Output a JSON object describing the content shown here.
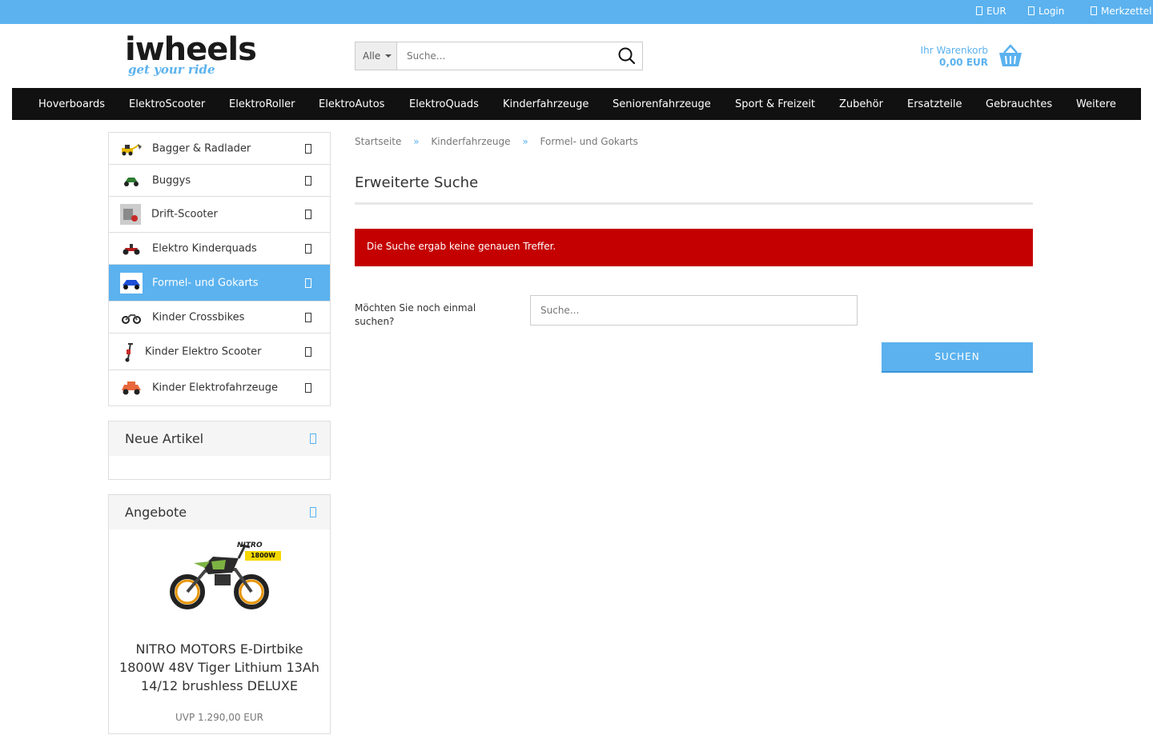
{
  "topbar": {
    "currency": "EUR",
    "login": "Login",
    "wishlist": "Merkzettel"
  },
  "logo": {
    "main": "iwheels",
    "tagline": "get your ride"
  },
  "search": {
    "category": "Alle",
    "placeholder": "Suche..."
  },
  "cart": {
    "label": "Ihr Warenkorb",
    "total": "0,00 EUR"
  },
  "nav": [
    "Hoverboards",
    "ElektroScooter",
    "ElektroRoller",
    "ElektroAutos",
    "ElektroQuads",
    "Kinderfahrzeuge",
    "Seniorenfahrzeuge",
    "Sport & Freizeit",
    "Zubehör",
    "Ersatzteile",
    "Gebrauchtes",
    "Weitere"
  ],
  "sidebar": {
    "categories": [
      {
        "label": "Bagger & Radlader"
      },
      {
        "label": "Buggys"
      },
      {
        "label": "Drift-Scooter"
      },
      {
        "label": "Elektro Kinderquads"
      },
      {
        "label": "Formel- und Gokarts",
        "active": true
      },
      {
        "label": "Kinder Crossbikes"
      },
      {
        "label": "Kinder Elektro Scooter"
      },
      {
        "label": "Kinder Elektrofahrzeuge"
      }
    ],
    "new_articles": {
      "title": "Neue Artikel"
    },
    "offers": {
      "title": "Angebote",
      "product_title": "NITRO MOTORS E-Dirtbike 1800W 48V Tiger Lithium 13Ah 14/12 brushless DELUXE",
      "product_price": "UVP 1.290,00 EUR",
      "badge_brand": "NITRO",
      "badge_power": "1800W"
    }
  },
  "breadcrumb": {
    "items": [
      "Startseite",
      "Kinderfahrzeuge",
      "Formel- und Gokarts"
    ],
    "separator": "»"
  },
  "main": {
    "title": "Erweiterte Suche",
    "alert": "Die Suche ergab keine genauen Treffer.",
    "ask_label": "Möchten Sie noch einmal suchen?",
    "search_placeholder": "Suche...",
    "submit": "SUCHEN"
  },
  "colors": {
    "accent": "#5bb2ef",
    "nav_bg": "#111111",
    "alert_bg": "#c40000"
  }
}
